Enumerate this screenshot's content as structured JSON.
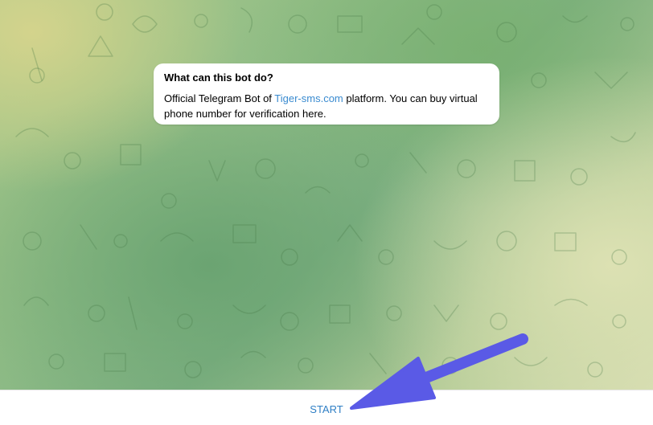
{
  "bubble": {
    "title": "What can this bot do?",
    "text_before": "Official Telegram Bot of ",
    "link": "Tiger-sms.com",
    "text_after": " platform. You can buy virtual phone number for verification here."
  },
  "bottom_bar": {
    "start_label": "START"
  },
  "colors": {
    "link": "#3a8bd0",
    "start": "#2f7fc5",
    "arrow": "#5a5ae6"
  }
}
